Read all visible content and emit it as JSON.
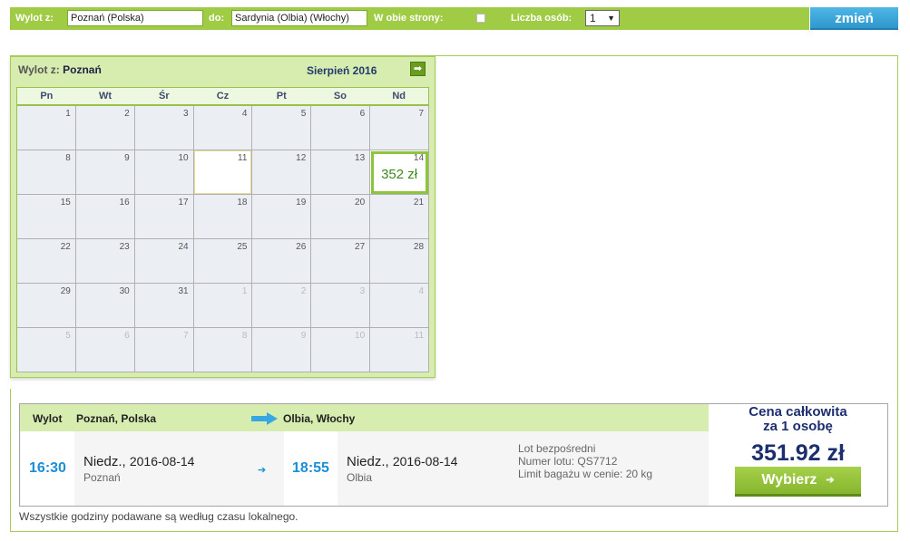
{
  "search": {
    "from_label": "Wylot z:",
    "from_value": "Poznań (Polska)",
    "to_label": "do:",
    "to_value": "Sardynia (Olbia) (Włochy)",
    "roundtrip_label": "W obie strony:",
    "persons_label": "Liczba osób:",
    "persons_value": "1",
    "change_button": "zmień"
  },
  "calendar": {
    "from_prefix": "Wylot z:",
    "from_city": "Poznań",
    "month_label": "Sierpień 2016",
    "days_of_week": [
      "Pn",
      "Wt",
      "Śr",
      "Cz",
      "Pt",
      "So",
      "Nd"
    ],
    "weeks": [
      [
        "1",
        "2",
        "3",
        "4",
        "5",
        "6",
        "7"
      ],
      [
        "8",
        "9",
        "10",
        "11",
        "12",
        "13",
        "14"
      ],
      [
        "15",
        "16",
        "17",
        "18",
        "19",
        "20",
        "21"
      ],
      [
        "22",
        "23",
        "24",
        "25",
        "26",
        "27",
        "28"
      ],
      [
        "29",
        "30",
        "31",
        "1",
        "2",
        "3",
        "4"
      ],
      [
        "5",
        "6",
        "7",
        "8",
        "9",
        "10",
        "11"
      ]
    ],
    "price_on_14": "352 zł"
  },
  "flight": {
    "header_label": "Wylot",
    "origin": "Poznań, Polska",
    "destination": "Olbia, Włochy",
    "depart_time": "16:30",
    "depart_day": "Niedz.,",
    "depart_date": "2016-08-14",
    "depart_city": "Poznań",
    "arrive_time": "18:55",
    "arrive_day": "Niedz.,",
    "arrive_date": "2016-08-14",
    "arrive_city": "Olbia",
    "info_direct": "Lot bezpośredni",
    "info_flight_no": "Numer lotu: QS7712",
    "info_baggage": "Limit bagażu w cenie: 20 kg",
    "price_caption_1": "Cena całkowita",
    "price_caption_2": "za 1 osobę",
    "price_total": "351.92 zł",
    "select_button": "Wybierz"
  },
  "footnote": "Wszystkie godziny podawane są według czasu lokalnego.",
  "colors": {
    "accent_green": "#9fcb45",
    "button_blue": "#2f97cc",
    "time_blue": "#1a8fd6",
    "price_navy": "#1d2e6e"
  }
}
